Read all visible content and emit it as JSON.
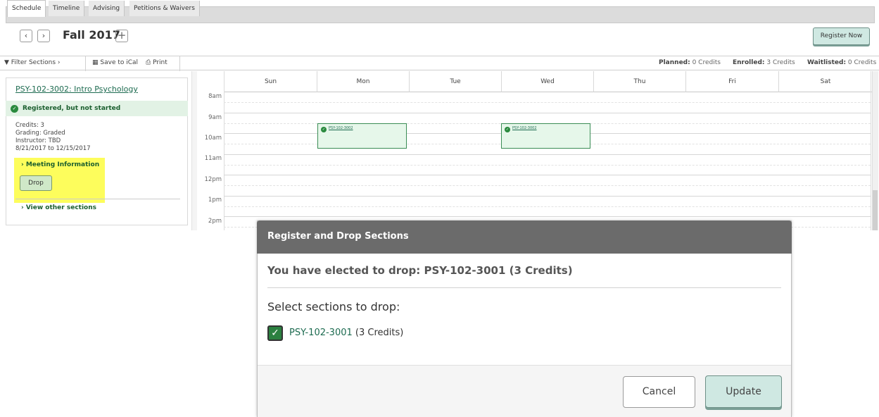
{
  "tabs": [
    "Schedule",
    "Timeline",
    "Advising",
    "Petitions & Waivers"
  ],
  "header": {
    "prev_label": "‹",
    "next_label": "›",
    "term": "Fall 2017",
    "add_label": "+",
    "register_now": "Register Now"
  },
  "toolbar": {
    "filter": "Filter Sections ›",
    "ical": "Save to iCal",
    "print": "Print",
    "planned_label": "Planned:",
    "planned_value": "0 Credits",
    "enrolled_label": "Enrolled:",
    "enrolled_value": "3 Credits",
    "waitlisted_label": "Waitlisted:",
    "waitlisted_value": "0 Credits"
  },
  "section": {
    "title": "PSY-102-3002: Intro Psychology",
    "status": "Registered, but not started",
    "credits": "Credits: 3",
    "grading": "Grading: Graded",
    "instructor": "Instructor: TBD",
    "dates": "8/21/2017 to 12/15/2017",
    "meeting": "› Meeting Information",
    "drop": "Drop",
    "view_other": "› View other sections"
  },
  "calendar": {
    "days": [
      "Sun",
      "Mon",
      "Tue",
      "Wed",
      "Thu",
      "Fri",
      "Sat"
    ],
    "hours": [
      "8am",
      "9am",
      "10am",
      "11am",
      "12pm",
      "1pm",
      "2pm"
    ],
    "events": [
      {
        "day": "Mon",
        "label": "PSY-102-3002"
      },
      {
        "day": "Wed",
        "label": "PSY-102-3002"
      }
    ]
  },
  "modal": {
    "title": "Register and Drop Sections",
    "subtitle": "You have elected to drop: PSY-102-3001 (3 Credits)",
    "select_label": "Select sections to drop:",
    "item_code": "PSY-102-3001",
    "item_credits": " (3 Credits)",
    "cancel": "Cancel",
    "update": "Update"
  },
  "colors": {
    "accent_green": "#1d6b50",
    "button_teal": "#cfe8e2",
    "highlight_yellow": "#fdfd5c",
    "modal_header": "#6b6b6b"
  }
}
